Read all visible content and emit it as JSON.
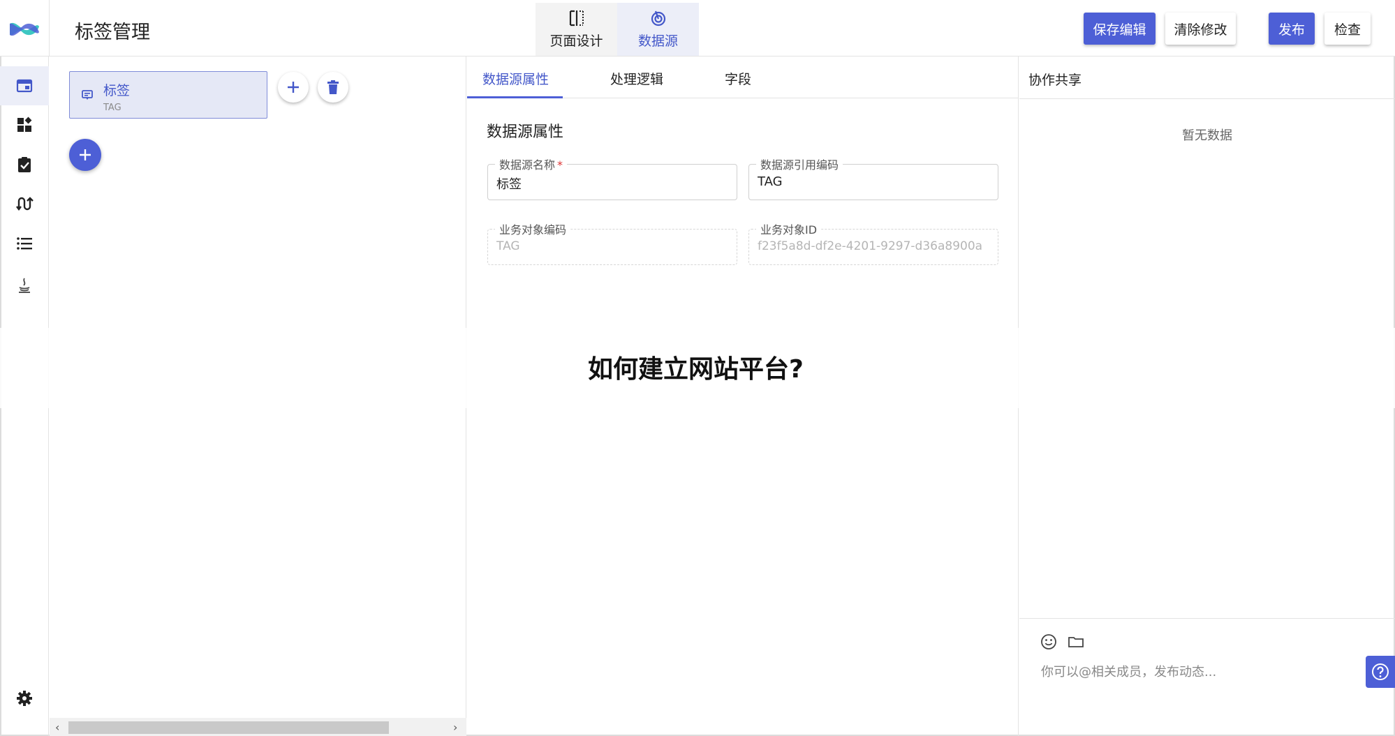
{
  "header": {
    "title": "标签管理",
    "mode_tabs": [
      {
        "label": "页面设计",
        "icon": "split-view-icon",
        "active": false
      },
      {
        "label": "数据源",
        "icon": "datasource-icon",
        "active": true
      }
    ],
    "buttons": {
      "save": "保存编辑",
      "clear": "清除修改",
      "publish": "发布",
      "check": "检查"
    }
  },
  "sidebar": {
    "items": [
      {
        "icon": "page-icon",
        "active": true
      },
      {
        "icon": "widgets-icon",
        "active": false
      },
      {
        "icon": "clipboard-check-icon",
        "active": false
      },
      {
        "icon": "flow-icon",
        "active": false
      },
      {
        "icon": "list-icon",
        "active": false
      },
      {
        "icon": "java-icon",
        "active": false
      }
    ],
    "bottom_icon": "gear-icon"
  },
  "datasource_list": {
    "items": [
      {
        "name": "标签",
        "code": "TAG"
      }
    ]
  },
  "detail": {
    "tabs": [
      "数据源属性",
      "处理逻辑",
      "字段"
    ],
    "active_tab": 0,
    "section_title": "数据源属性",
    "fields": {
      "name": {
        "label": "数据源名称",
        "required_mark": "*",
        "value": "标签"
      },
      "ref_code": {
        "label": "数据源引用编码",
        "value": "TAG"
      },
      "biz_code": {
        "label": "业务对象编码",
        "value": "TAG"
      },
      "biz_id": {
        "label": "业务对象ID",
        "value": "f23f5a8d-df2e-4201-9297-d36a8900a"
      }
    }
  },
  "overlay": {
    "title": "如何建立网站平台?"
  },
  "collab": {
    "title": "协作共享",
    "empty_text": "暂无数据",
    "input_placeholder": "你可以@相关成员，发布动态..."
  },
  "colors": {
    "primary": "#4d5fd6",
    "active_bg": "#eceef8",
    "required": "#dd3333"
  }
}
